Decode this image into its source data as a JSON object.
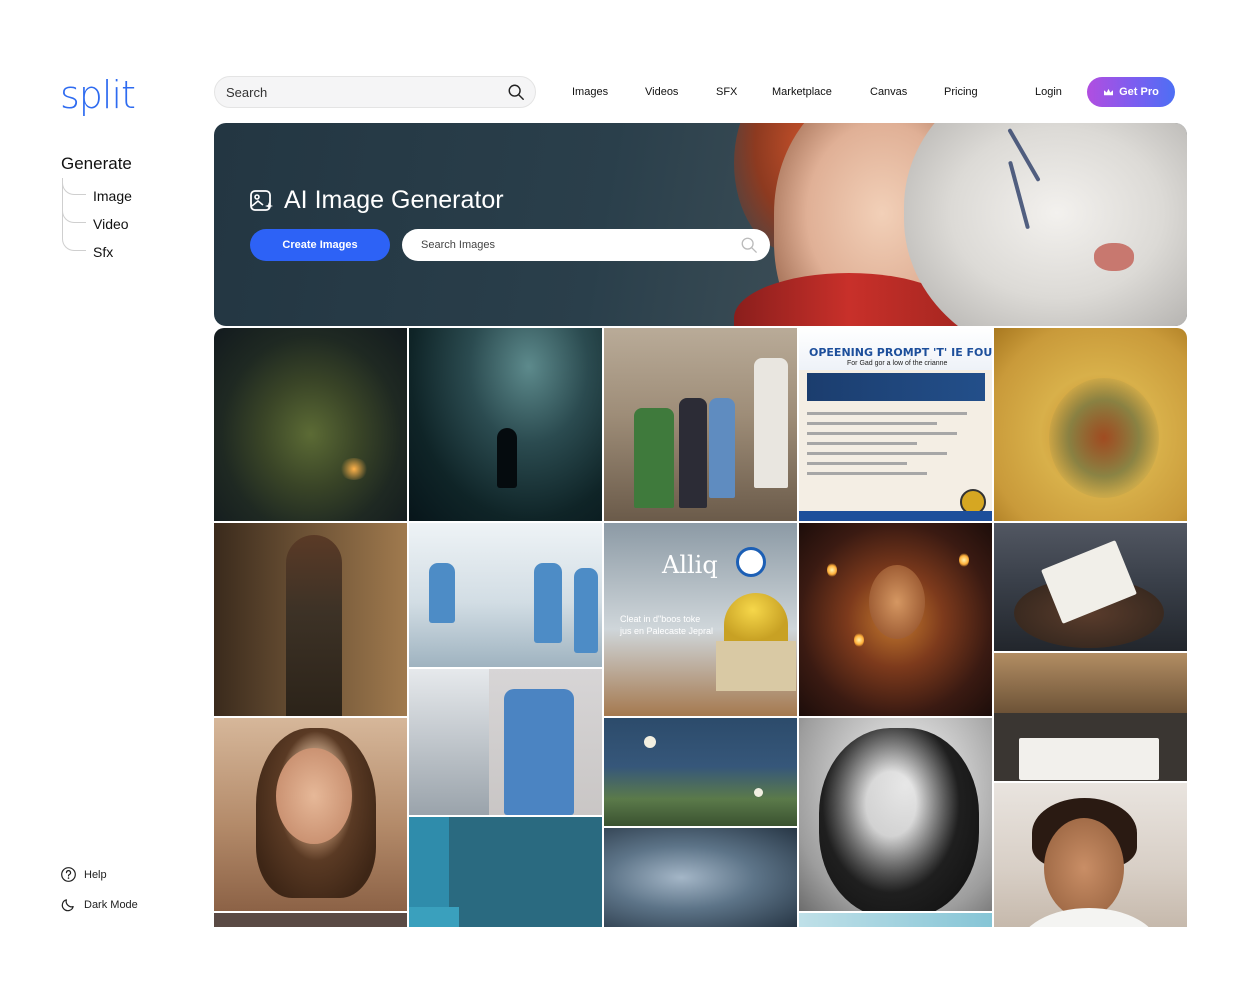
{
  "app": {
    "logo_text": "split",
    "accent_color": "#2e6bf0"
  },
  "sidebar": {
    "section_title": "Generate",
    "items": [
      {
        "label": "Image"
      },
      {
        "label": "Video"
      },
      {
        "label": "Sfx"
      }
    ],
    "help_label": "Help",
    "dark_mode_label": "Dark Mode"
  },
  "header": {
    "search_placeholder": "Search",
    "nav": [
      {
        "label": "Images"
      },
      {
        "label": "Videos"
      },
      {
        "label": "SFX"
      },
      {
        "label": "Marketplace"
      },
      {
        "label": "Canvas"
      },
      {
        "label": "Pricing"
      }
    ],
    "login_label": "Login",
    "get_pro_label": "Get Pro"
  },
  "hero": {
    "title": "AI Image Generator",
    "create_button_label": "Create Images",
    "search_placeholder": "Search Images"
  },
  "gallery": {
    "poster_title": "OPEENING PROMPT 'T' IE FOURNIUN CLKT",
    "poster_subtitle": "For Gad gor a low of the crianne",
    "ad_logo": "Alliq",
    "ad_text_1": "Cleat in d\"boos toke",
    "ad_text_2": "jus en Palecaste Jepral"
  }
}
